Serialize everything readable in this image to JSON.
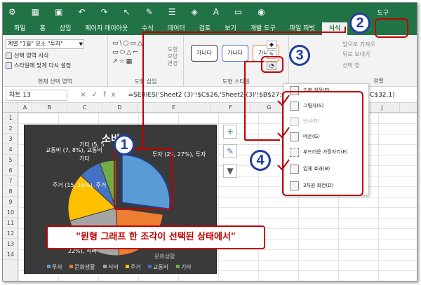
{
  "colors": {
    "excel_green": "#217346",
    "annotation_red": "#c00000",
    "annotation_blue": "#1f3f9e"
  },
  "titlebar": {
    "icons": [
      "settings-icon",
      "table-icon",
      "save-icon",
      "undo-icon",
      "redo-icon",
      "cursor-icon",
      "paint-icon",
      "border-icon",
      "fill-color-icon",
      "font-color-icon",
      "window-icon",
      "camera-icon"
    ],
    "right_text": "도구"
  },
  "tabs": [
    {
      "label": "파일"
    },
    {
      "label": "홈"
    },
    {
      "label": "삽입"
    },
    {
      "label": "페이지 레이아웃"
    },
    {
      "label": "수식"
    },
    {
      "label": "데이터"
    },
    {
      "label": "검토"
    },
    {
      "label": "보기"
    },
    {
      "label": "개발 도구"
    },
    {
      "label": "파일 피벗"
    },
    {
      "label": "서식",
      "active": true
    }
  ],
  "ribbon": {
    "selection_combo": "계열 \"1월\" 요소 \"투자\"",
    "format_selection": "선택 영역 서식",
    "reset_style": "스타일에 맞게 다시 설정",
    "current_selection_label": "현재 선택 영역",
    "shapes_glyphs": "▭\\○▭△ ▭⬭△⌐ ↗☆▦",
    "change_shape": "도형 모양 변경",
    "insert_shapes_label": "도형 삽입",
    "style_text": "가나다",
    "shape_styles_label": "도형 스타일",
    "bring_forward": "앞으로 가져오",
    "send_backward": "뒤로 보내기",
    "selection_pane": "선택 창",
    "arrange_label": "정렬"
  },
  "formula_bar": {
    "name_box": "차트 13",
    "cancel": "×",
    "enter": "✓",
    "fx": "fx",
    "formula": "=SERIES('Sheet2 (3)'!$C$26,'Sheet2 (3)'!$B$27:$B$32,'Sheet2 (3)'!$C$27:$C$32,1)"
  },
  "columns": [
    "A",
    "B",
    "C",
    "D",
    "E",
    "F",
    "G",
    "H",
    "I",
    "J"
  ],
  "rows": [
    "1",
    "2",
    "3",
    "4",
    "5",
    "6",
    "7",
    "8",
    "9",
    "10",
    "11",
    "12",
    "13",
    "14"
  ],
  "chart": {
    "title": "소비",
    "labels": {
      "invest": "투자 (25, 27%), 투자",
      "edu": "교통비 (7, 8%), 교통비",
      "other": "기타 (5, 5",
      "other2": "기타",
      "housing": "주거 (15, 16%), 주거",
      "food": "22%), 식비",
      "culture": "문화생활"
    },
    "legend": [
      "투자",
      "문화생활",
      "식비",
      "주거",
      "교통비",
      "기타"
    ],
    "legend_colors": [
      "#5b9bd5",
      "#ed7d31",
      "#a5a5a5",
      "#ffc000",
      "#4472c4",
      "#70ad47"
    ]
  },
  "chart_data": {
    "type": "pie",
    "categories": [
      "투자",
      "문화생활",
      "식비",
      "주거",
      "교통비",
      "기타"
    ],
    "values": [
      25,
      20,
      20,
      15,
      7,
      5
    ],
    "title": "소비"
  },
  "menu": {
    "items": [
      {
        "label": "기본 설정(P)",
        "disabled": false
      },
      {
        "label": "그림자(S)",
        "disabled": false
      },
      {
        "label": "반사(R)",
        "disabled": true
      },
      {
        "label": "네온(G)",
        "disabled": false
      },
      {
        "label": "부드러운 가장자리(E)",
        "disabled": false
      },
      {
        "label": "입체 효과(B)",
        "disabled": false
      },
      {
        "label": "3차원 회전(D)",
        "disabled": false
      }
    ]
  },
  "annotations": {
    "step1": "1",
    "step2": "2",
    "step3": "3",
    "step4": "4",
    "caption": "\"원형 그래프 한 조각이 선택된 상태에서\""
  }
}
